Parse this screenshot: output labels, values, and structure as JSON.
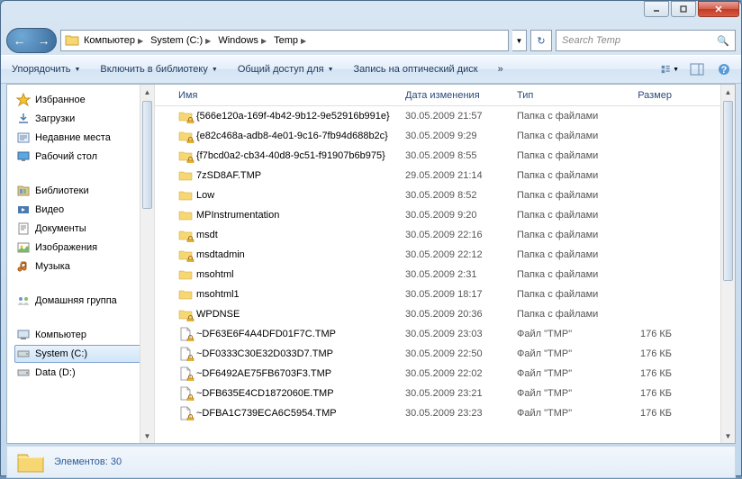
{
  "breadcrumbs": [
    "Компьютер",
    "System (C:)",
    "Windows",
    "Temp"
  ],
  "search_placeholder": "Search Temp",
  "toolbar": {
    "organize": "Упорядочить",
    "include": "Включить в библиотеку",
    "share": "Общий доступ для",
    "burn": "Запись на оптический диск"
  },
  "columns": {
    "name": "Имя",
    "date": "Дата изменения",
    "type": "Тип",
    "size": "Размер"
  },
  "sidebar": {
    "favorites": {
      "label": "Избранное",
      "items": [
        "Загрузки",
        "Недавние места",
        "Рабочий стол"
      ]
    },
    "libraries": {
      "label": "Библиотеки",
      "items": [
        "Видео",
        "Документы",
        "Изображения",
        "Музыка"
      ]
    },
    "homegroup": {
      "label": "Домашняя группа"
    },
    "computer": {
      "label": "Компьютер",
      "items": [
        "System (C:)",
        "Data (D:)"
      ]
    }
  },
  "files": [
    {
      "icon": "folder",
      "locked": true,
      "name": "{566e120a-169f-4b42-9b12-9e52916b991e}",
      "date": "30.05.2009 21:57",
      "type": "Папка с файлами",
      "size": ""
    },
    {
      "icon": "folder",
      "locked": true,
      "name": "{e82c468a-adb8-4e01-9c16-7fb94d688b2c}",
      "date": "30.05.2009 9:29",
      "type": "Папка с файлами",
      "size": ""
    },
    {
      "icon": "folder",
      "locked": true,
      "name": "{f7bcd0a2-cb34-40d8-9c51-f91907b6b975}",
      "date": "30.05.2009 8:55",
      "type": "Папка с файлами",
      "size": ""
    },
    {
      "icon": "folder",
      "locked": false,
      "name": "7zSD8AF.TMP",
      "date": "29.05.2009 21:14",
      "type": "Папка с файлами",
      "size": ""
    },
    {
      "icon": "folder",
      "locked": false,
      "name": "Low",
      "date": "30.05.2009 8:52",
      "type": "Папка с файлами",
      "size": ""
    },
    {
      "icon": "folder",
      "locked": false,
      "name": "MPInstrumentation",
      "date": "30.05.2009 9:20",
      "type": "Папка с файлами",
      "size": ""
    },
    {
      "icon": "folder",
      "locked": true,
      "name": "msdt",
      "date": "30.05.2009 22:16",
      "type": "Папка с файлами",
      "size": ""
    },
    {
      "icon": "folder",
      "locked": true,
      "name": "msdtadmin",
      "date": "30.05.2009 22:12",
      "type": "Папка с файлами",
      "size": ""
    },
    {
      "icon": "folder",
      "locked": false,
      "name": "msohtml",
      "date": "30.05.2009 2:31",
      "type": "Папка с файлами",
      "size": ""
    },
    {
      "icon": "folder",
      "locked": false,
      "name": "msohtml1",
      "date": "30.05.2009 18:17",
      "type": "Папка с файлами",
      "size": ""
    },
    {
      "icon": "folder",
      "locked": true,
      "name": "WPDNSE",
      "date": "30.05.2009 20:36",
      "type": "Папка с файлами",
      "size": ""
    },
    {
      "icon": "file",
      "locked": true,
      "name": "~DF63E6F4A4DFD01F7C.TMP",
      "date": "30.05.2009 23:03",
      "type": "Файл \"TMP\"",
      "size": "176 КБ"
    },
    {
      "icon": "file",
      "locked": true,
      "name": "~DF0333C30E32D033D7.TMP",
      "date": "30.05.2009 22:50",
      "type": "Файл \"TMP\"",
      "size": "176 КБ"
    },
    {
      "icon": "file",
      "locked": true,
      "name": "~DF6492AE75FB6703F3.TMP",
      "date": "30.05.2009 22:02",
      "type": "Файл \"TMP\"",
      "size": "176 КБ"
    },
    {
      "icon": "file",
      "locked": true,
      "name": "~DFB635E4CD1872060E.TMP",
      "date": "30.05.2009 23:21",
      "type": "Файл \"TMP\"",
      "size": "176 КБ"
    },
    {
      "icon": "file",
      "locked": true,
      "name": "~DFBA1C739ECA6C5954.TMP",
      "date": "30.05.2009 23:23",
      "type": "Файл \"TMP\"",
      "size": "176 КБ"
    }
  ],
  "status": {
    "count_label": "Элементов: 30"
  }
}
